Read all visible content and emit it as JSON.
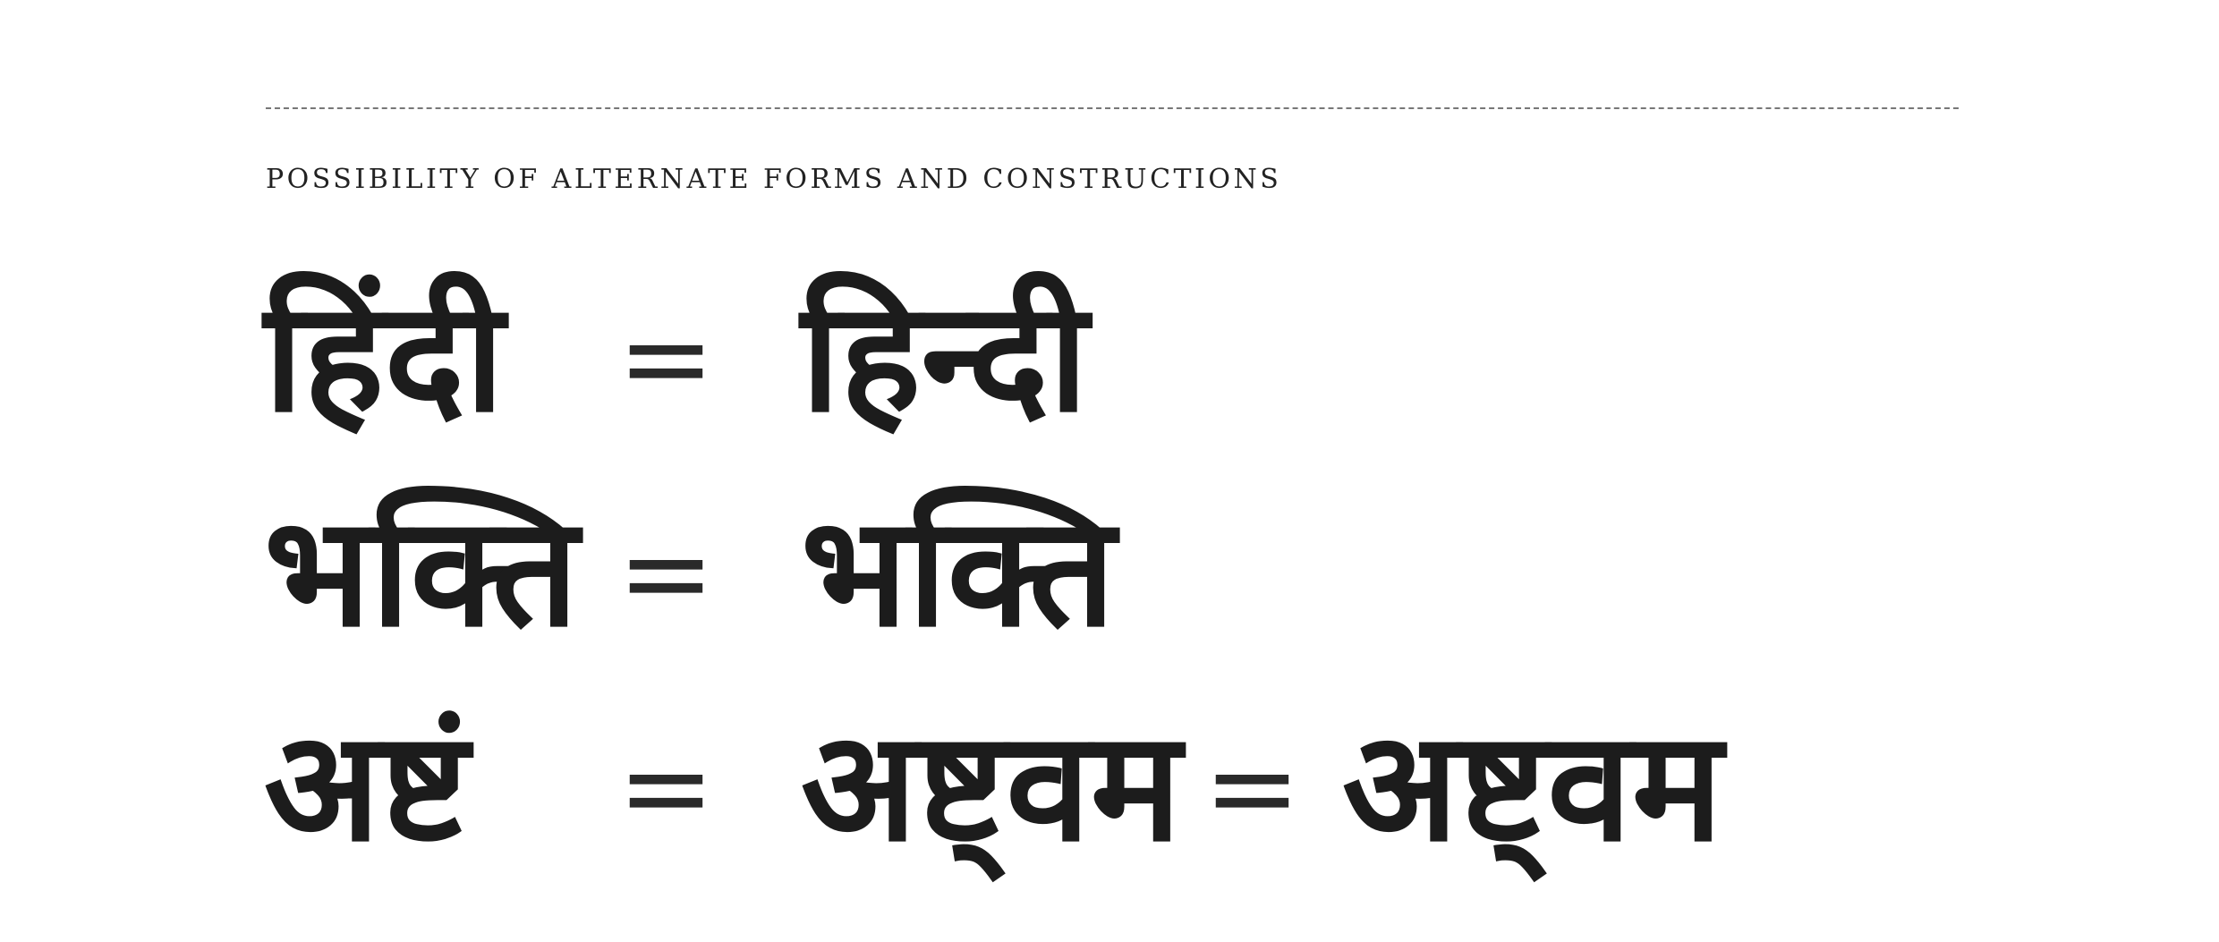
{
  "caption": "POSSIBILITY OF ALTERNATE FORMS AND CONSTRUCTIONS",
  "rows": [
    {
      "forms": [
        "हिंदी",
        "हिन्दी"
      ],
      "separator": "="
    },
    {
      "forms": [
        "भक्ति",
        "भक्ति"
      ],
      "separator": "="
    },
    {
      "forms": [
        "अष्टं",
        "अष्ट्वम",
        "अष्ट्वम"
      ],
      "separator": "="
    }
  ]
}
